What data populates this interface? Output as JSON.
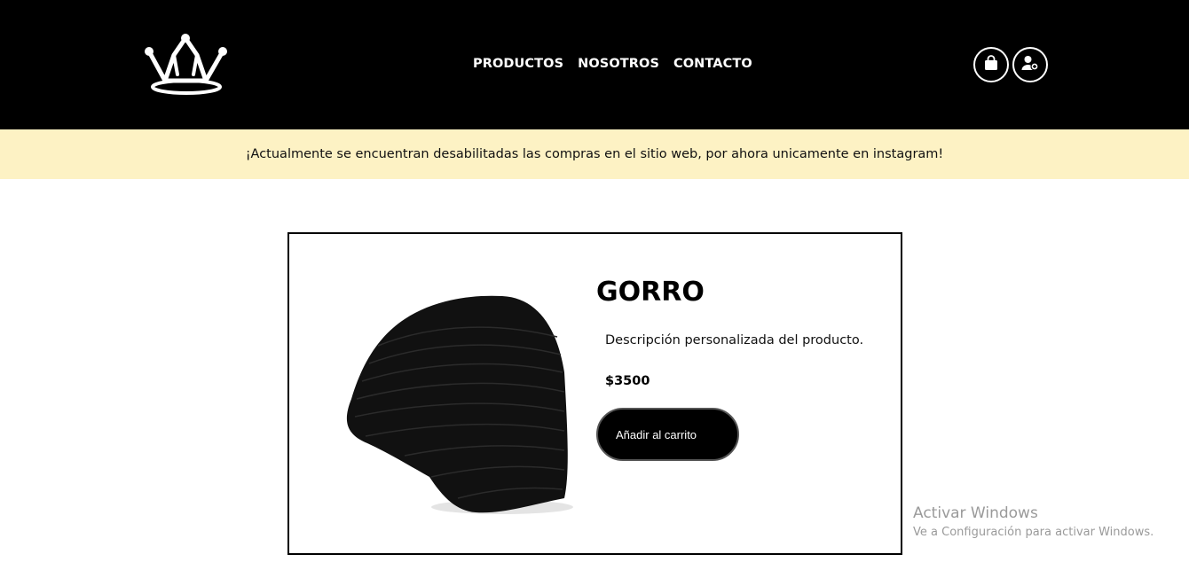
{
  "header": {
    "logo_icon": "crown-icon",
    "nav": {
      "productos": "PRODUCTOS",
      "nosotros": "NOSOTROS",
      "contacto": "CONTACTO"
    },
    "cart_icon": "shopping-bag-icon",
    "user_icon": "user-add-icon"
  },
  "banner": {
    "text": "¡Actualmente se encuentran desabilitadas las compras en el sitio web, por ahora unicamente en instagram!",
    "background": "#fdf2c4"
  },
  "product": {
    "title": "GORRO",
    "description": "Descripción personalizada del producto.",
    "price": "$3500",
    "add_to_cart_label": "Añadir al carrito",
    "image_icon": "beanie-hat-image"
  },
  "watermark": {
    "title": "Activar Windows",
    "subtitle": "Ve a Configuración para activar Windows."
  },
  "colors": {
    "header_bg": "#000000",
    "banner_bg": "#fdf2c4",
    "button_bg": "#000000",
    "text": "#111111"
  }
}
